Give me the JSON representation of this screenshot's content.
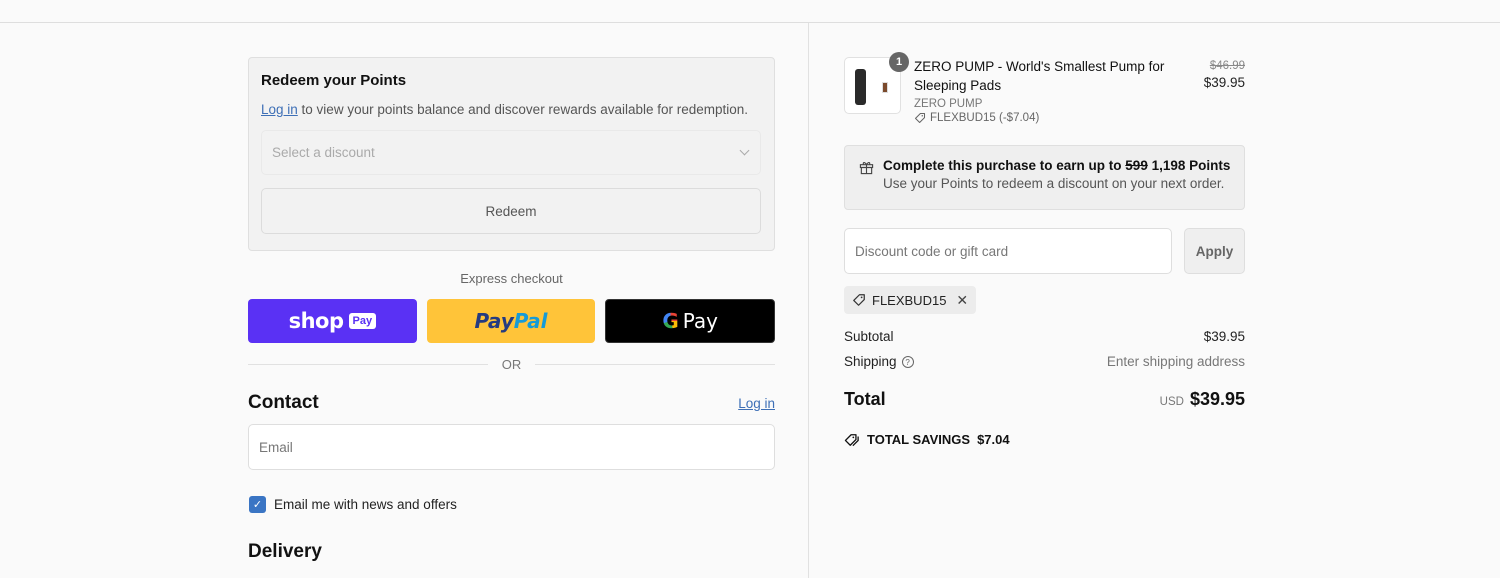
{
  "redeem": {
    "title": "Redeem your Points",
    "login_link": "Log in",
    "description": " to view your points balance and discover rewards available for redemption.",
    "select_placeholder": "Select a discount",
    "button": "Redeem"
  },
  "express": {
    "label": "Express checkout",
    "shop_pay": {
      "word": "shop",
      "badge": "Pay"
    },
    "paypal": {
      "part1": "Pay",
      "part2": "Pal"
    },
    "gpay": {
      "g": "G",
      "word": "Pay"
    },
    "or": "OR"
  },
  "contact": {
    "heading": "Contact",
    "login_link": "Log in",
    "email_placeholder": "Email",
    "newsletter_label": "Email me with news and offers",
    "newsletter_checked": true
  },
  "delivery": {
    "heading": "Delivery"
  },
  "summary": {
    "item": {
      "quantity": "1",
      "name": "ZERO PUMP - World's Smallest Pump for Sleeping Pads",
      "vendor": "ZERO PUMP",
      "discount": "FLEXBUD15 (-$7.04)",
      "original_price": "$46.99",
      "price": "$39.95"
    },
    "points": {
      "title_prefix": "Complete this purchase to earn up to ",
      "old_points": "599",
      "new_points": "1,198 Points",
      "subtitle": "Use your Points to redeem a discount on your next order."
    },
    "discount_placeholder": "Discount code or gift card",
    "apply_button": "Apply",
    "applied_code": "FLEXBUD15",
    "subtotal_label": "Subtotal",
    "subtotal_value": "$39.95",
    "shipping_label": "Shipping",
    "shipping_value": "Enter shipping address",
    "total_label": "Total",
    "currency": "USD",
    "total_value": "$39.95",
    "savings_label": "TOTAL SAVINGS",
    "savings_value": "$7.04"
  }
}
